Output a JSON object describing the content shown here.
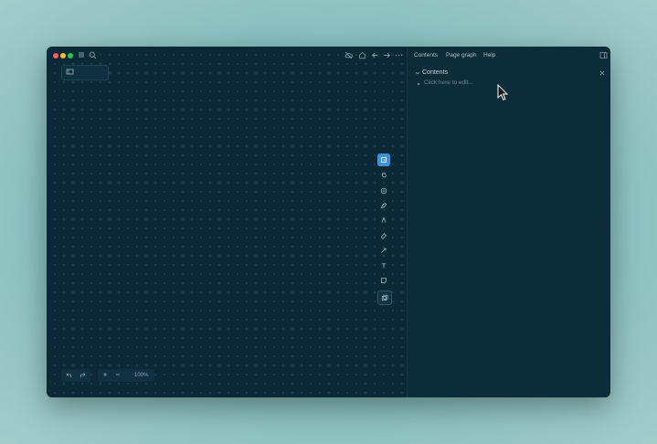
{
  "tabs": [
    {
      "label": "Contents"
    },
    {
      "label": "Page graph"
    },
    {
      "label": "Help"
    }
  ],
  "panel": {
    "heading": "Contents",
    "placeholder": "Click here to edit..."
  },
  "zoom": {
    "label": "100%"
  },
  "window_controls": {
    "close_color": "#ff5f57",
    "minimize_color": "#febc2e",
    "maximize_color": "#28c840"
  },
  "tools": [
    {
      "icon": "select-icon",
      "active": true
    },
    {
      "icon": "hand-icon"
    },
    {
      "icon": "shape-icon"
    },
    {
      "icon": "pen-icon"
    },
    {
      "icon": "highlighter-icon"
    },
    {
      "icon": "eraser-icon"
    },
    {
      "icon": "connector-icon"
    },
    {
      "icon": "text-icon"
    },
    {
      "icon": "sticky-note-icon"
    },
    {
      "icon": "embed-icon"
    }
  ],
  "accent_color": "#3d93d9"
}
